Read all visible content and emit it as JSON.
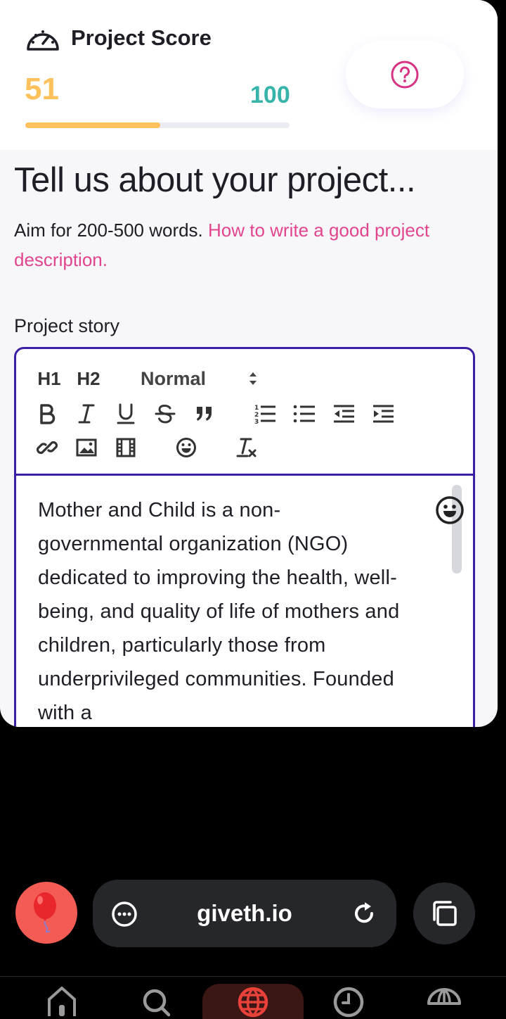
{
  "score": {
    "title": "Project Score",
    "value": "51",
    "max": "100",
    "progress_fraction": 0.51,
    "help_icon": "question-circle-icon"
  },
  "form": {
    "heading": "Tell us about your project...",
    "hint_text": "Aim for 200-500 words. ",
    "hint_link": "How to write a good project description.",
    "story_label": "Project story"
  },
  "editor": {
    "toolbar": {
      "h1": "H1",
      "h2": "H2",
      "format_select": "Normal"
    },
    "content": "Mother and Child is a non-governmental organization (NGO) dedicated to improving the health, well-being, and quality of life of mothers and children, particularly those from underprivileged communities. Founded with a"
  },
  "browser": {
    "url": "giveth.io"
  },
  "colors": {
    "score_accent": "#ffc15b",
    "max_accent": "#37b4a9",
    "link": "#e1458d",
    "editor_border": "#3c1fa6",
    "balloon": "#f25c54"
  }
}
